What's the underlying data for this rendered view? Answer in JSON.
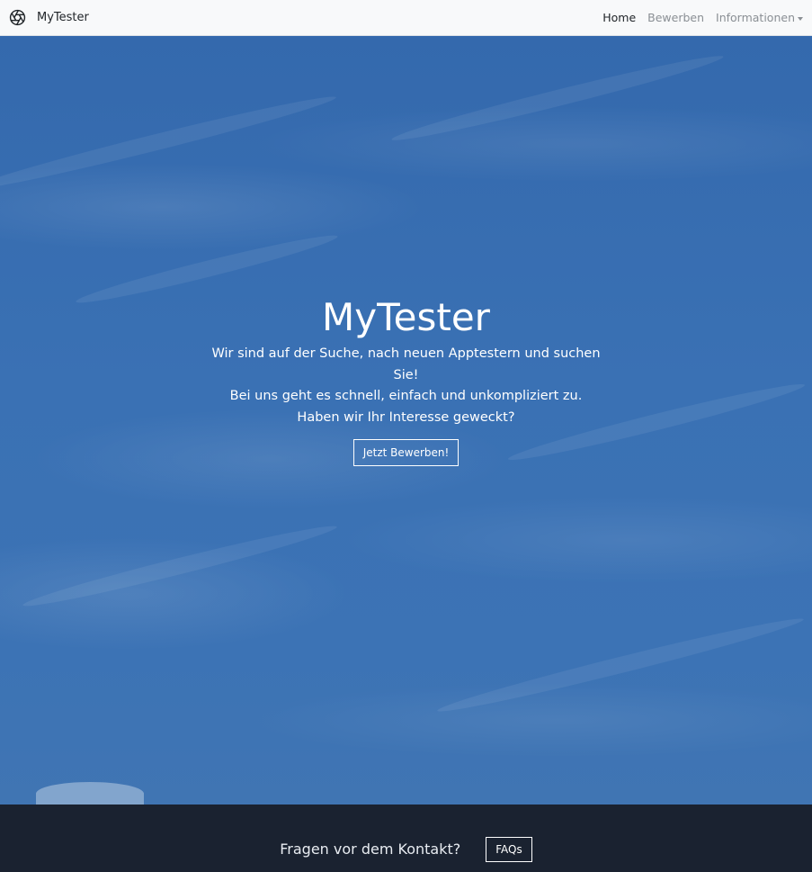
{
  "navbar": {
    "brand": "MyTester",
    "brand_icon": "aperture-icon",
    "links": [
      {
        "label": "Home",
        "active": true
      },
      {
        "label": "Bewerben",
        "active": false
      },
      {
        "label": "Informationen",
        "active": false,
        "dropdown": true
      }
    ]
  },
  "hero": {
    "title": "MyTester",
    "line1": "Wir sind auf der Suche, nach neuen Apptestern und suchen Sie!",
    "line2": "Bei uns geht es schnell, einfach und unkompliziert zu.",
    "line3": "Haben wir Ihr Interesse geweckt?",
    "button": "Jetzt Bewerben!"
  },
  "footer": {
    "text": "Fragen vor dem Kontakt?",
    "button": "FAQs"
  },
  "colors": {
    "sky": "#3a6fb0",
    "footer_bg": "#1a2230",
    "navbar_bg": "#f8f9fa"
  }
}
